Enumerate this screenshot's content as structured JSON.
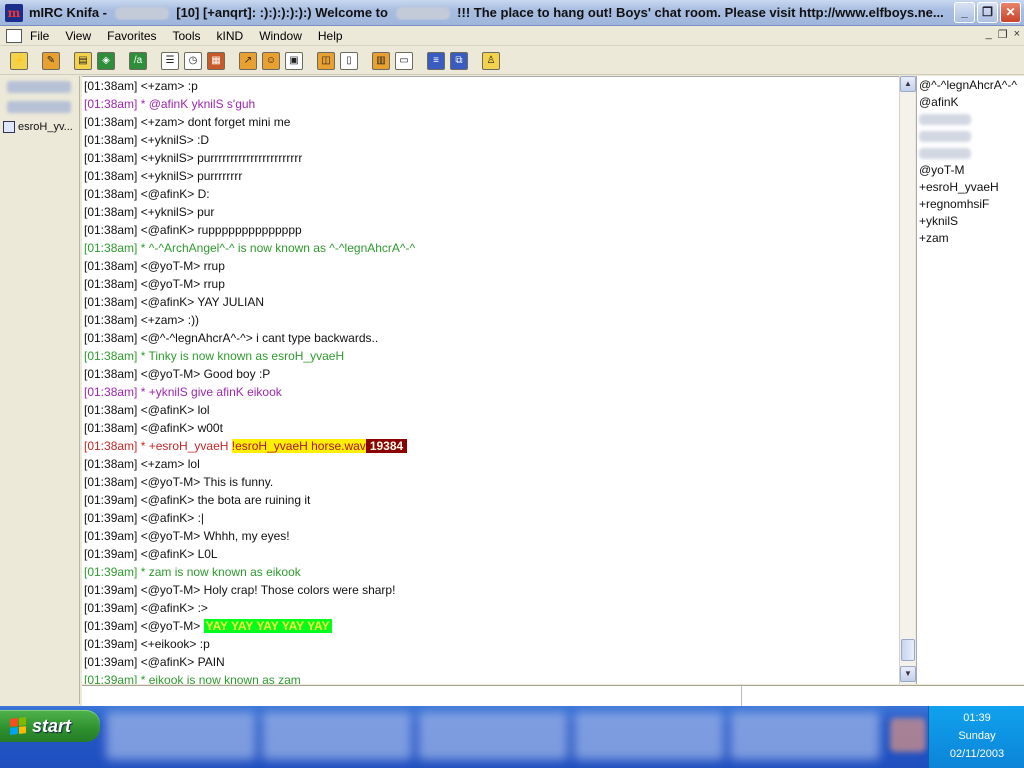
{
  "window": {
    "title_prefix": "mIRC Knifa - ",
    "title_suffix": " [10] [+anqrt]:  :):):):):):)  Welcome to ",
    "title_tail": " !!! The place to hang out! Boys' chat room. Please visit http://www.elfboys.ne...",
    "controls": {
      "minimize": "_",
      "restore": "❐",
      "close": "✕"
    }
  },
  "menu": {
    "items": [
      "File",
      "View",
      "Favorites",
      "Tools",
      "kIND",
      "Window",
      "Help"
    ],
    "mdi": {
      "minimize": "_",
      "restore": "❐",
      "close": "×"
    }
  },
  "switchbar": {
    "items": [
      {
        "label": ""
      },
      {
        "label": ""
      },
      {
        "label": "esroH_yv..."
      }
    ]
  },
  "chat": {
    "lines": [
      {
        "t": "[01:38am] <+zam> :p",
        "c": "black"
      },
      {
        "t": "[01:38am] * @afinK yknilS s'guh",
        "c": "purple"
      },
      {
        "t": "[01:38am] <+zam> dont forget mini me",
        "c": "black"
      },
      {
        "t": "[01:38am] <+yknilS> :D",
        "c": "black"
      },
      {
        "t": "[01:38am] <+yknilS> purrrrrrrrrrrrrrrrrrrrrrr",
        "c": "black"
      },
      {
        "t": "[01:38am] <+yknilS> purrrrrrrr",
        "c": "black"
      },
      {
        "t": "[01:38am] <@afinK> D:",
        "c": "black"
      },
      {
        "t": "[01:38am] <+yknilS> pur",
        "c": "black"
      },
      {
        "t": "[01:38am] <@afinK> rupppppppppppppp",
        "c": "black"
      },
      {
        "t": "[01:38am] * ^-^ArchAngel^-^ is now known as ^-^legnAhcrA^-^",
        "c": "green"
      },
      {
        "t": "[01:38am] <@yoT-M> rrup",
        "c": "black"
      },
      {
        "t": "[01:38am] <@yoT-M> rrup",
        "c": "black"
      },
      {
        "t": "[01:38am] <@afinK> YAY JULIAN",
        "c": "black"
      },
      {
        "t": "[01:38am] <+zam> :))",
        "c": "black"
      },
      {
        "t": "[01:38am] <@^-^legnAhcrA^-^> i cant type backwards..",
        "c": "black"
      },
      {
        "t": "[01:38am] * Tinky is now known as esroH_yvaeH",
        "c": "green"
      },
      {
        "t": "[01:38am] <@yoT-M> Good boy :P",
        "c": "black"
      },
      {
        "t": "[01:38am] * +yknilS give afinK eikook",
        "c": "purple"
      },
      {
        "t": "[01:38am] <@afinK> lol",
        "c": "black"
      },
      {
        "t": "[01:38am] <@afinK> w00t",
        "c": "black"
      },
      {
        "t": "[01:38am] * +esroH_yvaeH ",
        "c": "red",
        "hl1": "!esroH_yvaeH horse.wav",
        "hl2": "19384"
      },
      {
        "t": "[01:38am] <+zam> lol",
        "c": "black"
      },
      {
        "t": "[01:38am] <@yoT-M> This is funny.",
        "c": "black"
      },
      {
        "t": "[01:39am] <@afinK> the bota are ruining it",
        "c": "black"
      },
      {
        "t": "[01:39am] <@afinK> :|",
        "c": "black"
      },
      {
        "t": "[01:39am] <@yoT-M> Whhh, my eyes!",
        "c": "black"
      },
      {
        "t": "[01:39am] <@afinK> L0L",
        "c": "black"
      },
      {
        "t": "[01:39am] * zam is now known as eikook",
        "c": "green"
      },
      {
        "t": "[01:39am] <@yoT-M> Holy crap! Those colors were sharp!",
        "c": "black"
      },
      {
        "t": "[01:39am] <@afinK> :>",
        "c": "black"
      },
      {
        "t": "[01:39am] <@yoT-M> ",
        "c": "black",
        "hlg": "YAY YAY YAY YAY YAY"
      },
      {
        "t": "[01:39am] <+eikook> :p",
        "c": "black"
      },
      {
        "t": "[01:39am] <@afinK> PAIN",
        "c": "black"
      },
      {
        "t": "[01:39am] * eikook is now known as zam",
        "c": "green"
      }
    ]
  },
  "scrollbar": {
    "up": "▲",
    "down": "▼"
  },
  "nicklist": [
    {
      "nick": "@^-^legnAhcrA^-^"
    },
    {
      "nick": "@afinK"
    },
    {
      "nick": ""
    },
    {
      "nick": ""
    },
    {
      "nick": ""
    },
    {
      "nick": "@yoT-M"
    },
    {
      "nick": "+esroH_yvaeH"
    },
    {
      "nick": "+regnomhsiF"
    },
    {
      "nick": "+yknilS"
    },
    {
      "nick": "+zam"
    }
  ],
  "taskbar": {
    "start_label": "start",
    "clock": {
      "time": "01:39",
      "day": "Sunday",
      "date": "02/11/2003"
    }
  },
  "colors": {
    "text_default": "#111111",
    "text_action": "#9c27b0",
    "text_nickchange": "#2e9b2e",
    "text_sound": "#c62828",
    "taskbar": "#2456c7",
    "start": "#2d8f2d"
  },
  "icons": {
    "toolbar": [
      "connect-icon",
      "options-icon",
      "address-book-icon",
      "firewall-icon",
      "script-editor-icon",
      "channel-list-icon",
      "timer-icon",
      "colors-icon",
      "dcc-send-icon",
      "dcc-chat-icon",
      "notify-icon",
      "url-icon",
      "log-icon",
      "notes-icon",
      "tile-windows-icon",
      "cascade-windows-icon",
      "about-icon"
    ]
  }
}
